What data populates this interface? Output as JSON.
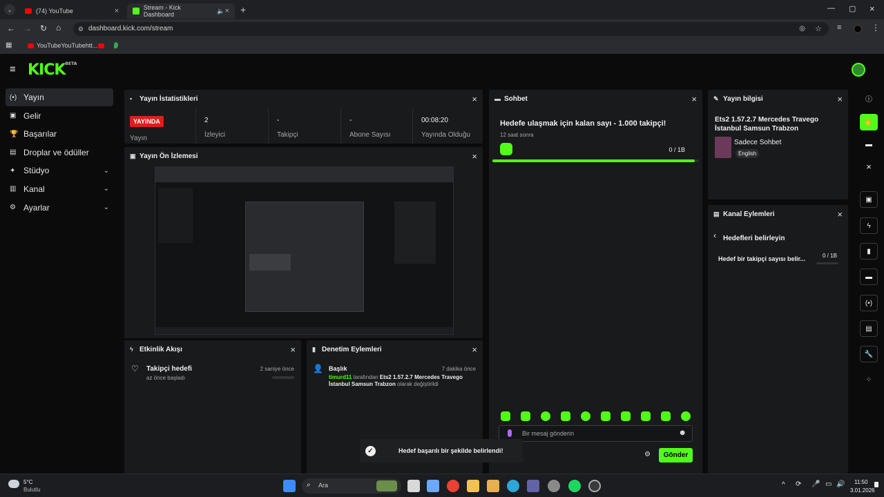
{
  "browser": {
    "tabs": [
      {
        "title": "(74) YouTube",
        "active": false
      },
      {
        "title": "Stream - Kick Dashboard",
        "active": true
      }
    ],
    "url": "dashboard.kick.com/stream",
    "bookmark": "YouTubeYouTubehtt..."
  },
  "brand": {
    "logo": "KICK",
    "badge": "BETA",
    "accent": "#53fc18"
  },
  "sidebar": {
    "items": [
      {
        "label": "Yayın",
        "icon": "broadcast-icon",
        "active": true
      },
      {
        "label": "Gelir",
        "icon": "revenue-icon"
      },
      {
        "label": "Başarılar",
        "icon": "trophy-icon"
      },
      {
        "label": "Droplar ve ödüller",
        "icon": "gift-icon"
      },
      {
        "label": "Stüdyo",
        "icon": "studio-icon",
        "expandable": true
      },
      {
        "label": "Kanal",
        "icon": "channel-icon",
        "expandable": true
      },
      {
        "label": "Ayarlar",
        "icon": "settings-icon",
        "expandable": true
      }
    ]
  },
  "stats": {
    "title": "Yayın İstatistikleri",
    "live_badge": "YAYINDA",
    "items": [
      {
        "value": "",
        "label": "Yayın"
      },
      {
        "value": "2",
        "label": "İzleyici"
      },
      {
        "value": "-",
        "label": "Takipçi"
      },
      {
        "value": "-",
        "label": "Abone Sayısı"
      },
      {
        "value": "00:08:20",
        "label": "Yayında Olduğu"
      }
    ]
  },
  "preview": {
    "title": "Yayın Ön İzlemesi"
  },
  "activity": {
    "title": "Etkinlik Akışı",
    "items": [
      {
        "title": "Takipçi hedefi",
        "sub": "az önce başladı",
        "time": "2 saniye önce"
      }
    ]
  },
  "moderation": {
    "title": "Denetim Eylemleri",
    "items": [
      {
        "title": "Başlık",
        "time": "7 dakika önce",
        "user": "timurd11",
        "text": " tarafından ",
        "bold": "Ets2 1.57.2.7 Mercedes Travego İstanbul Samsun Trabzon",
        "tail": " olarak değiştirildi"
      }
    ]
  },
  "chat": {
    "title": "Sohbet",
    "goal_text": "Hedefe ulaşmak için kalan sayı - 1.000 takipçi!",
    "goal_time": "12 saat sonra",
    "goal_progress": "0 / 1B",
    "goal_fraction": 0.98,
    "input_placeholder": "Bir mesaj gönderin",
    "send_label": "Gönder"
  },
  "streaminfo": {
    "title": "Yayın bilgisi",
    "stream_title": "Ets2 1.57.2.7 Mercedes Travego İstanbul Samsun Trabzon",
    "category": "Sadece Sohbet",
    "language": "English"
  },
  "channel_actions": {
    "title": "Kanal Eylemleri",
    "back_label": "Hedefleri belirleyin",
    "goal_label": "Hedef bir takipçi sayısı belir...",
    "goal_progress": "0 / 1B"
  },
  "toast": {
    "text": "Hedef başarılı bir şekilde belirlendi!"
  },
  "taskbar": {
    "weather_temp": "5°C",
    "weather_desc": "Bulutlu",
    "search": "Ara",
    "time": "11:50",
    "date": "3.01.2026"
  }
}
